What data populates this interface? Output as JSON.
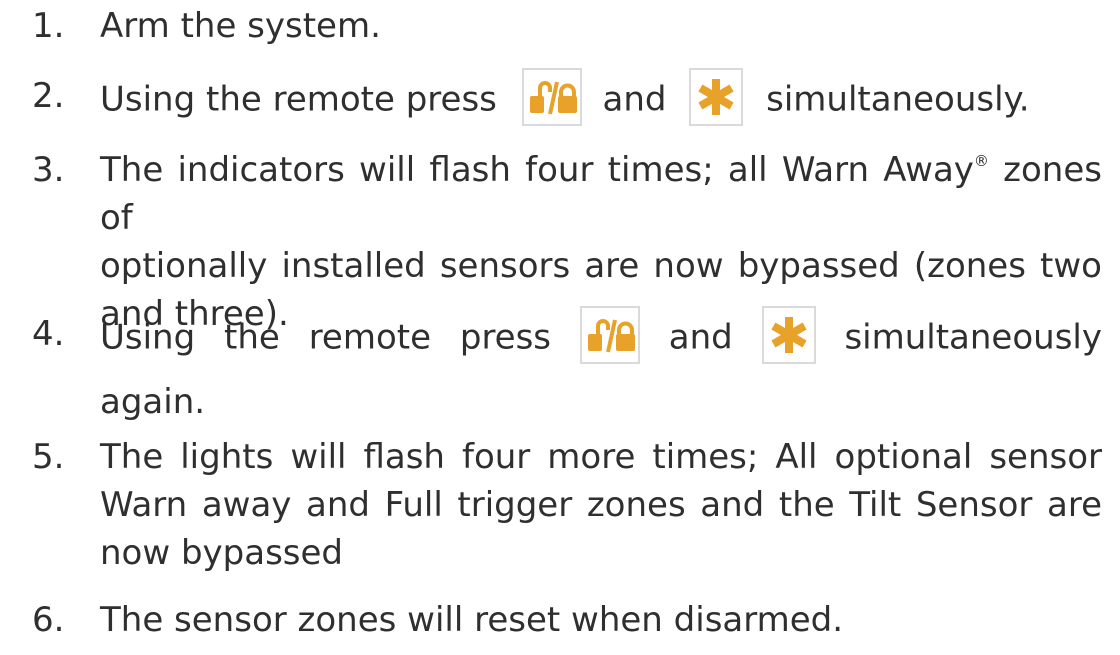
{
  "steps": [
    {
      "number": "1.",
      "lines": [
        "Arm the system."
      ]
    },
    {
      "number": "2.",
      "parts": [
        "Using the remote press",
        "and",
        "simultaneously."
      ]
    },
    {
      "number": "3.",
      "lines": [
        "The indicators will flash four times; all Warn Away",
        "zones of",
        "optionally installed sensors are now bypassed (zones two",
        "and three)."
      ],
      "registered_mark": "®"
    },
    {
      "number": "4.",
      "parts": [
        "Using the remote press",
        "and",
        "simultaneously",
        "again."
      ]
    },
    {
      "number": "5.",
      "lines": [
        "The lights will flash four more times; All optional sensor",
        "Warn away and Full trigger zones and the Tilt Sensor are",
        "now bypassed"
      ]
    },
    {
      "number": "6.",
      "lines": [
        "The sensor zones will reset when disarmed."
      ]
    }
  ],
  "icons": {
    "lock_button": "lock-unlock-icon",
    "star_button": "asterisk-icon",
    "icon_color": "#e8a22a",
    "border_color": "#dadada"
  },
  "colors": {
    "text": "#2f2f2f"
  }
}
